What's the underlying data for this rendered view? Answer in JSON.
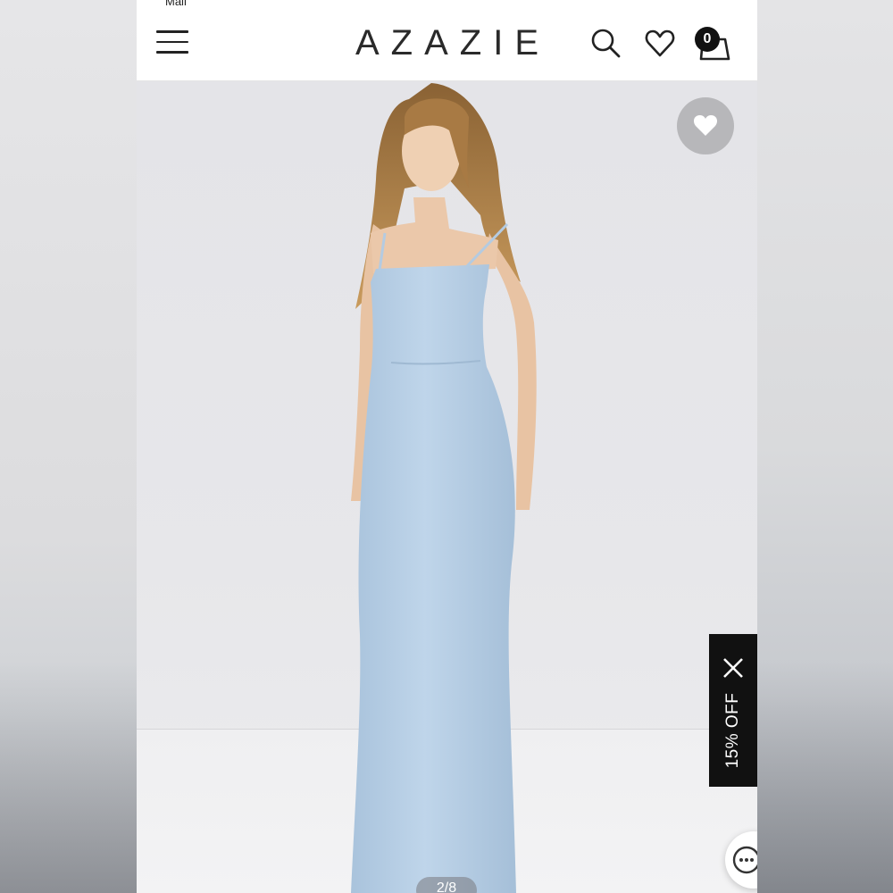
{
  "status_bar": {
    "fragment": "Mail"
  },
  "header": {
    "brand": "AZAZIE",
    "cart_count": "0"
  },
  "product_gallery": {
    "page_indicator": "2/8",
    "dress_color": "#b9cfe3"
  },
  "promo_tab": {
    "label": "15% OFF"
  },
  "icons": [
    "menu-icon",
    "search-icon",
    "heart-icon",
    "shopping-bag-icon",
    "close-icon",
    "chat-icon"
  ]
}
